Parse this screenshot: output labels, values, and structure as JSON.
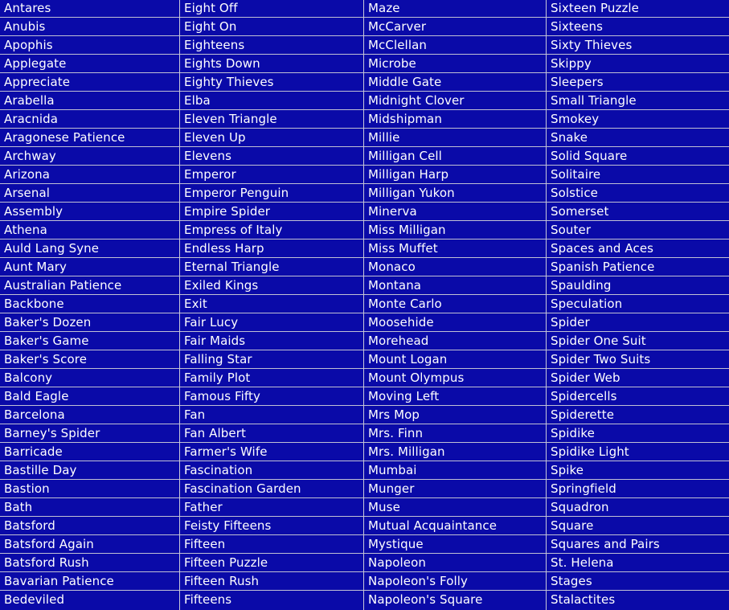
{
  "panel": {
    "name": "solitaire-game-list",
    "background_color": "#0a0aa8",
    "text_color": "#ffffff",
    "separator_color": "#c0c0d4",
    "divider_color": "#c8c8d8",
    "column_count": 4,
    "row_count": 33
  },
  "columns": [
    {
      "index": 0,
      "items": [
        "Antares",
        "Anubis",
        "Apophis",
        "Applegate",
        "Appreciate",
        "Arabella",
        "Aracnida",
        "Aragonese Patience",
        "Archway",
        "Arizona",
        "Arsenal",
        "Assembly",
        "Athena",
        "Auld Lang Syne",
        "Aunt Mary",
        "Australian Patience",
        "Backbone",
        "Baker's Dozen",
        "Baker's Game",
        "Baker's Score",
        "Balcony",
        "Bald Eagle",
        "Barcelona",
        "Barney's Spider",
        "Barricade",
        "Bastille Day",
        "Bastion",
        "Bath",
        "Batsford",
        "Batsford Again",
        "Batsford Rush",
        "Bavarian Patience",
        "Bedeviled"
      ]
    },
    {
      "index": 1,
      "items": [
        "Eight Off",
        "Eight On",
        "Eighteens",
        "Eights Down",
        "Eighty Thieves",
        "Elba",
        "Eleven Triangle",
        "Eleven Up",
        "Elevens",
        "Emperor",
        "Emperor Penguin",
        "Empire Spider",
        "Empress of Italy",
        "Endless Harp",
        "Eternal Triangle",
        "Exiled Kings",
        "Exit",
        "Fair Lucy",
        "Fair Maids",
        "Falling Star",
        "Family Plot",
        "Famous Fifty",
        "Fan",
        "Fan Albert",
        "Farmer's Wife",
        "Fascination",
        "Fascination Garden",
        "Father",
        "Feisty Fifteens",
        "Fifteen",
        "Fifteen Puzzle",
        "Fifteen Rush",
        "Fifteens"
      ]
    },
    {
      "index": 2,
      "items": [
        "Maze",
        "McCarver",
        "McClellan",
        "Microbe",
        "Middle Gate",
        "Midnight Clover",
        "Midshipman",
        "Millie",
        "Milligan Cell",
        "Milligan Harp",
        "Milligan Yukon",
        "Minerva",
        "Miss Milligan",
        "Miss Muffet",
        "Monaco",
        "Montana",
        "Monte Carlo",
        "Moosehide",
        "Morehead",
        "Mount Logan",
        "Mount Olympus",
        "Moving Left",
        "Mrs Mop",
        "Mrs. Finn",
        "Mrs. Milligan",
        "Mumbai",
        "Munger",
        "Muse",
        "Mutual Acquaintance",
        "Mystique",
        "Napoleon",
        "Napoleon's Folly",
        "Napoleon's Square"
      ]
    },
    {
      "index": 3,
      "items": [
        "Sixteen Puzzle",
        "Sixteens",
        "Sixty Thieves",
        "Skippy",
        "Sleepers",
        "Small Triangle",
        "Smokey",
        "Snake",
        "Solid Square",
        "Solitaire",
        "Solstice",
        "Somerset",
        "Souter",
        "Spaces and Aces",
        "Spanish Patience",
        "Spaulding",
        "Speculation",
        "Spider",
        "Spider One Suit",
        "Spider Two Suits",
        "Spider Web",
        "Spidercells",
        "Spiderette",
        "Spidike",
        "Spidike Light",
        "Spike",
        "Springfield",
        "Squadron",
        "Square",
        "Squares and Pairs",
        "St. Helena",
        "Stages",
        "Stalactites"
      ]
    }
  ]
}
